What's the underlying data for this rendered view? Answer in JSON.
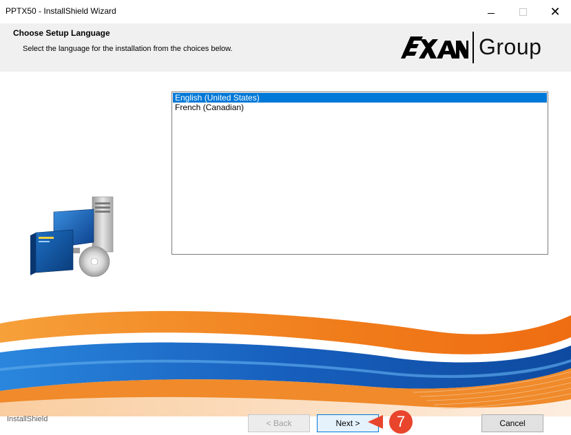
{
  "window": {
    "title": "PPTX50 - InstallShield Wizard"
  },
  "header": {
    "title": "Choose Setup Language",
    "subtitle": "Select the language for the installation from the choices below.",
    "logo_word": "Group",
    "logo_mark_text": "EXAN"
  },
  "language_list": {
    "items": [
      {
        "label": "English (United States)",
        "selected": true
      },
      {
        "label": "French (Canadian)",
        "selected": false
      }
    ]
  },
  "footer": {
    "brand": "InstallShield",
    "back_label": "< Back",
    "next_label": "Next >",
    "cancel_label": "Cancel"
  },
  "callout": {
    "step": "7",
    "color": "#e8452c"
  },
  "colors": {
    "selection": "#0078d7",
    "header_bg": "#f0f0f0",
    "swoosh_orange": "#f07c1a",
    "swoosh_blue": "#1f6cc7"
  }
}
